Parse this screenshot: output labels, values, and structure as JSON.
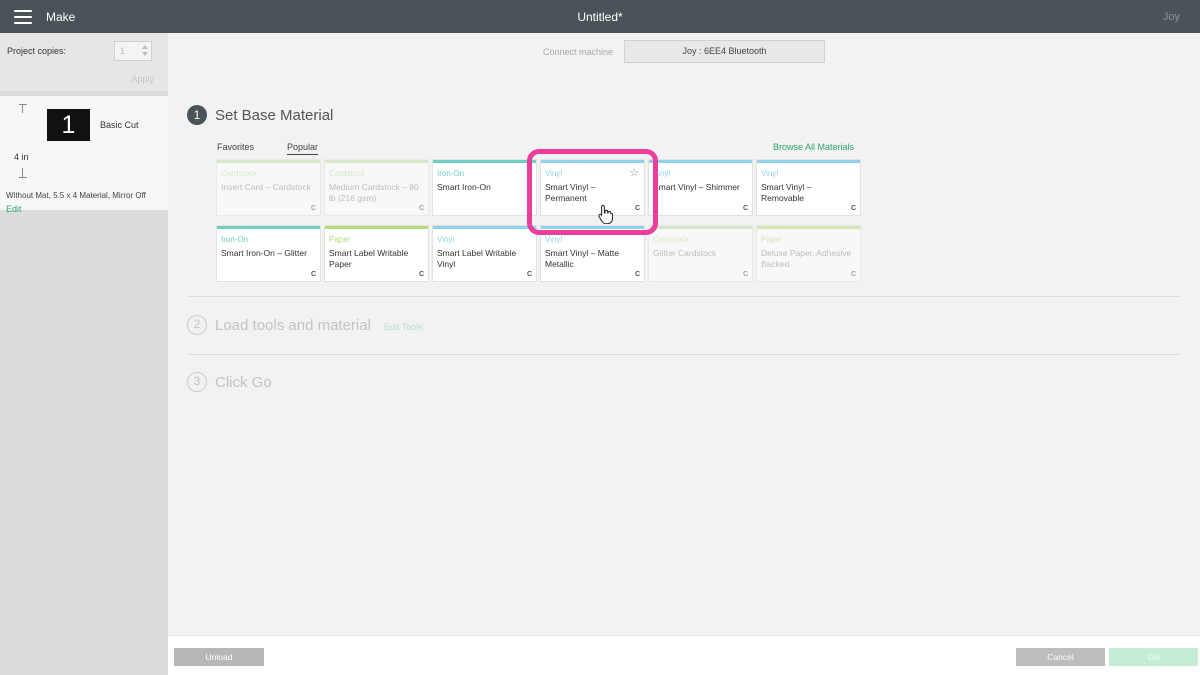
{
  "topbar": {
    "app_title": "Make",
    "doc_title": "Untitled*",
    "machine_name": "Joy"
  },
  "sidebar": {
    "copies_label": "Project copies:",
    "copies_value": "1",
    "apply_label": "Apply",
    "mat": {
      "dimension": "4 in",
      "thumb_number": "1",
      "cut_type": "Basic Cut",
      "info": "Without Mat, 5.5 x 4 Material, Mirror Off",
      "edit_label": "Edit"
    }
  },
  "connect": {
    "label": "Connect machine",
    "machine": "Joy : 6EE4 Bluetooth"
  },
  "steps": {
    "step1": {
      "num": "1",
      "title": "Set Base Material"
    },
    "step2": {
      "num": "2",
      "title": "Load tools and material",
      "edit_tools": "Edit Tools"
    },
    "step3": {
      "num": "3",
      "title": "Click Go"
    }
  },
  "tabs": {
    "favorites": "Favorites",
    "popular": "Popular",
    "browse_all": "Browse All Materials"
  },
  "materials": [
    {
      "category": "Cardstock",
      "name": "Insert Card – Cardstock",
      "color": "#b9e0a5",
      "muted": true
    },
    {
      "category": "Cardstock",
      "name": "Medium Cardstock – 80 lb (216 gsm)",
      "color": "#b9e0a5",
      "muted": true
    },
    {
      "category": "Iron-On",
      "name": "Smart Iron-On",
      "color": "#6fcfc0",
      "muted": false
    },
    {
      "category": "Vinyl",
      "name": "Smart Vinyl – Permanent",
      "color": "#8fd3ea",
      "muted": false
    },
    {
      "category": "Vinyl",
      "name": "Smart Vinyl – Shimmer",
      "color": "#8fd3ea",
      "muted": false
    },
    {
      "category": "Vinyl",
      "name": "Smart Vinyl – Removable",
      "color": "#8fd3ea",
      "muted": false
    },
    {
      "category": "Iron-On",
      "name": "Smart Iron-On – Glitter",
      "color": "#6fcfc0",
      "muted": false
    },
    {
      "category": "Paper",
      "name": "Smart Label Writable Paper",
      "color": "#b4dd78",
      "muted": false
    },
    {
      "category": "Vinyl",
      "name": "Smart Label Writable Vinyl",
      "color": "#8fd3ea",
      "muted": false
    },
    {
      "category": "Vinyl",
      "name": "Smart Vinyl – Matte Metallic",
      "color": "#8fd3ea",
      "muted": false
    },
    {
      "category": "Cardstock",
      "name": "Glitter Cardstock",
      "color": "#b9e0a5",
      "muted": true
    },
    {
      "category": "Paper",
      "name": "Deluxe Paper, Adhesive Backed",
      "color": "#b4dd78",
      "muted": true
    }
  ],
  "brand_mark": "C",
  "footer": {
    "unload": "Unload",
    "cancel": "Cancel",
    "go": "Go"
  },
  "colors": {
    "topbar": "#4a5358",
    "accent_green": "#29a86a",
    "highlight_pink": "#ea3e9c"
  }
}
